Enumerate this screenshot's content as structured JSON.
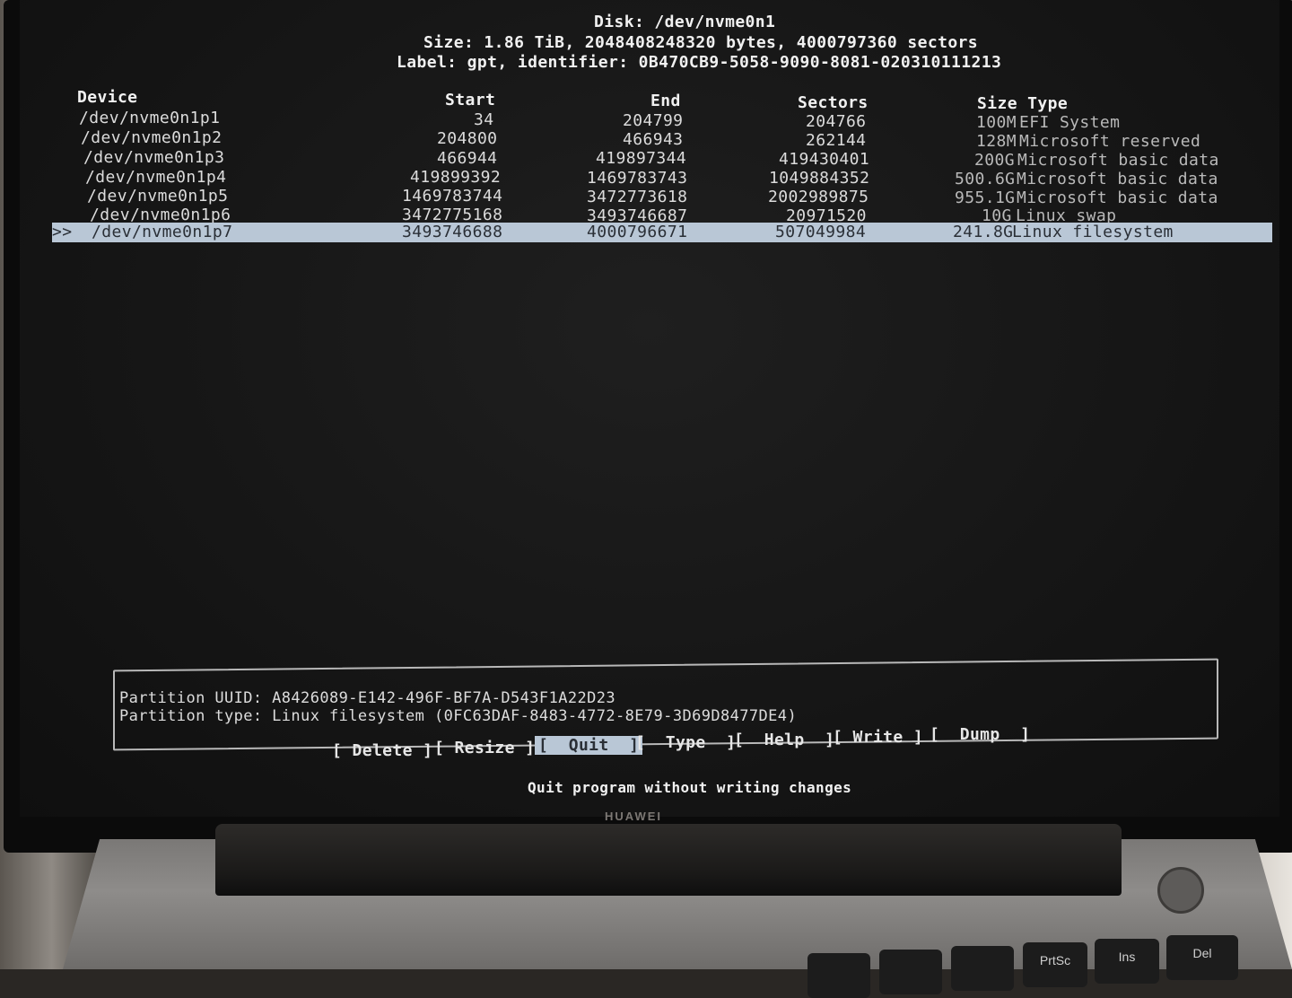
{
  "disk": {
    "title": "Disk: /dev/nvme0n1",
    "size_line": "Size: 1.86 TiB, 2048408248320 bytes, 4000797360 sectors",
    "label_line": "Label: gpt, identifier: 0B470CB9-5058-9090-8081-020310111213"
  },
  "columns": {
    "device": "Device",
    "start": "Start",
    "end": "End",
    "sectors": "Sectors",
    "size_type": "Size Type"
  },
  "partitions": [
    {
      "device": "/dev/nvme0n1p1",
      "start": "34",
      "end": "204799",
      "sectors": "204766",
      "size": "100M",
      "type": "EFI System"
    },
    {
      "device": "/dev/nvme0n1p2",
      "start": "204800",
      "end": "466943",
      "sectors": "262144",
      "size": "128M",
      "type": "Microsoft reserved"
    },
    {
      "device": "/dev/nvme0n1p3",
      "start": "466944",
      "end": "419897344",
      "sectors": "419430401",
      "size": "200G",
      "type": "Microsoft basic data"
    },
    {
      "device": "/dev/nvme0n1p4",
      "start": "419899392",
      "end": "1469783743",
      "sectors": "1049884352",
      "size": "500.6G",
      "type": "Microsoft basic data"
    },
    {
      "device": "/dev/nvme0n1p5",
      "start": "1469783744",
      "end": "3472773618",
      "sectors": "2002989875",
      "size": "955.1G",
      "type": "Microsoft basic data"
    },
    {
      "device": "/dev/nvme0n1p6",
      "start": "3472775168",
      "end": "3493746687",
      "sectors": "20971520",
      "size": "10G",
      "type": "Linux swap"
    },
    {
      "device": "/dev/nvme0n1p7",
      "start": "3493746688",
      "end": "4000796671",
      "sectors": "507049984",
      "size": "241.8G",
      "type": "Linux filesystem"
    }
  ],
  "selection_marker": ">>",
  "info": {
    "uuid_line": "Partition UUID: A8426089-E142-496F-BF7A-D543F1A22D23",
    "type_line": "Partition type: Linux filesystem (0FC63DAF-8483-4772-8E79-3D69D8477DE4)"
  },
  "menu": {
    "delete": "[ Delete ]",
    "resize": "[ Resize ]",
    "quit": "[  Quit  ]",
    "type": "[  Type  ]",
    "help": "[  Help  ]",
    "write": "[ Write ]",
    "dump": "[  Dump  ]"
  },
  "hint": "Quit program without writing changes",
  "brand": "HUAWEI",
  "keys": {
    "prtsc": "PrtSc",
    "ins": "Ins",
    "del": "Del"
  }
}
